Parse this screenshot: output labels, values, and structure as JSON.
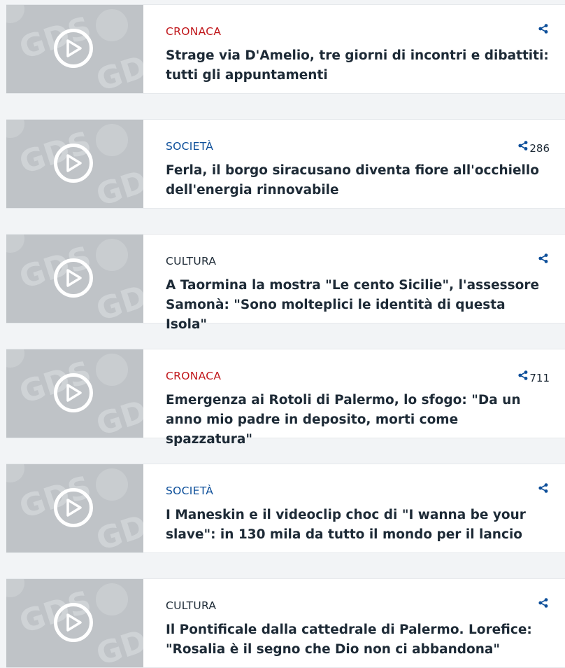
{
  "articles": [
    {
      "category": "CRONACA",
      "category_color": "#c0161a",
      "title": "Strage via D'Amelio, tre giorni di incontri e dibattiti: tutti gli appuntamenti",
      "shares": ""
    },
    {
      "category": "SOCIETÀ",
      "category_color": "#0d4f9a",
      "title": "Ferla, il borgo siracusano diventa fiore all'occhiello dell'energia rinnovabile",
      "shares": "286"
    },
    {
      "category": "CULTURA",
      "category_color": "#1d2a36",
      "title": "A Taormina la mostra \"Le cento Sicilie\", l'assessore Samonà: \"Sono molteplici le identità di questa Isola\"",
      "shares": ""
    },
    {
      "category": "CRONACA",
      "category_color": "#c0161a",
      "title": "Emergenza ai Rotoli di Palermo, lo sfogo: \"Da un anno mio padre in deposito, morti come spazzatura\"",
      "shares": "711"
    },
    {
      "category": "SOCIETÀ",
      "category_color": "#0d4f9a",
      "title": "I Maneskin e il videoclip choc di \"I wanna be your slave\": in 130 mila da tutto il mondo per il lancio",
      "shares": ""
    },
    {
      "category": "CULTURA",
      "category_color": "#1d2a36",
      "title": "Il Pontificale dalla cattedrale di Palermo. Lorefice: \"Rosalia è il segno che Dio non ci abbandona\"",
      "shares": ""
    }
  ],
  "thumbnail_watermark": "GDS",
  "icons": {
    "play": "play-icon",
    "share": "share-icon"
  }
}
